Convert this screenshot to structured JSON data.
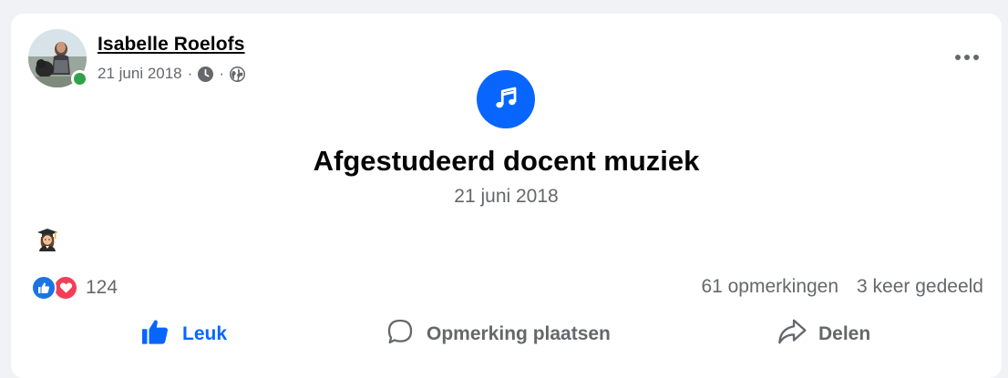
{
  "post": {
    "author": "Isabelle Roelofs",
    "date": "21 juni 2018",
    "meta_separator": "·",
    "more_icon": "more-horizontal-icon",
    "life_event": {
      "icon": "music-note-icon",
      "title": "Afgestudeerd docent muziek",
      "date": "21 juni 2018"
    },
    "body_emoji": "woman-graduate-emoji",
    "reactions": {
      "types": [
        "like",
        "love"
      ],
      "count": "124"
    },
    "comments_count": "61 opmerkingen",
    "shares_count": "3 keer gedeeld",
    "actions": {
      "like": "Leuk",
      "comment": "Opmerking plaatsen",
      "share": "Delen"
    }
  },
  "colors": {
    "brand_blue": "#0866ff",
    "secondary_text": "#65676b",
    "online_green": "#31a24c",
    "love_red": "#f33e58"
  }
}
